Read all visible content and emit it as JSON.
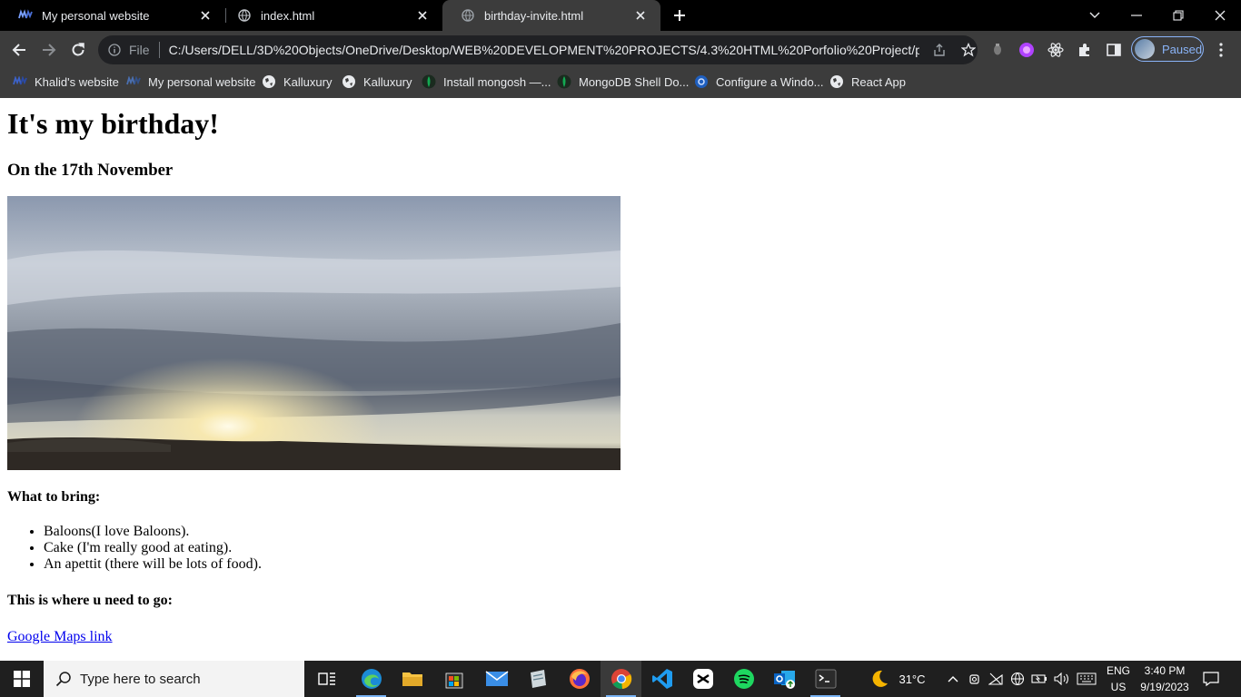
{
  "browser": {
    "tabs": [
      {
        "title": "My personal website",
        "icon": "tab-favicon-icon"
      },
      {
        "title": "index.html",
        "icon": "globe-icon"
      },
      {
        "title": "birthday-invite.html",
        "icon": "globe-icon",
        "active": true
      }
    ],
    "address": {
      "scheme": "File",
      "url": "C:/Users/DELL/3D%20Objects/OneDrive/Desktop/WEB%20DEVELOPMENT%20PROJECTS/4.3%20HTML%20Porfolio%20Project/publi..."
    },
    "profile": {
      "label": "Paused"
    },
    "bookmarks": [
      {
        "label": "Khalid's website",
        "icon": "site-icon"
      },
      {
        "label": "My personal website",
        "icon": "site-icon"
      },
      {
        "label": "Kalluxury",
        "icon": "globe-icon"
      },
      {
        "label": "Kalluxury",
        "icon": "globe-icon"
      },
      {
        "label": "Install mongosh —...",
        "icon": "mongodb-leaf-icon"
      },
      {
        "label": "MongoDB Shell Do...",
        "icon": "mongodb-leaf-icon"
      },
      {
        "label": "Configure a Windo...",
        "icon": "settings-globe-icon"
      },
      {
        "label": "React App",
        "icon": "globe-icon"
      }
    ]
  },
  "page": {
    "heading": "It's my birthday!",
    "date_line": "On the 17th November",
    "image": {
      "subject": "sunset-sky-photo"
    },
    "bring_heading": "What to bring:",
    "bring_items": [
      "Baloons(I love Baloons).",
      "Cake (I'm really good at eating).",
      "An apettit (there will be lots of food)."
    ],
    "where_heading": "This is where u need to go:",
    "map_link": "Google Maps link"
  },
  "taskbar": {
    "search_placeholder": "Type here to search",
    "weather": "31°C",
    "lang_top": "ENG",
    "lang_bottom": "US",
    "time": "3:40 PM",
    "date": "9/19/2023"
  },
  "colors": {
    "tab_strip": "#000000",
    "toolbar": "#3c3c3c",
    "link": "#0000ee",
    "profile_accent": "#8ab4f8"
  }
}
